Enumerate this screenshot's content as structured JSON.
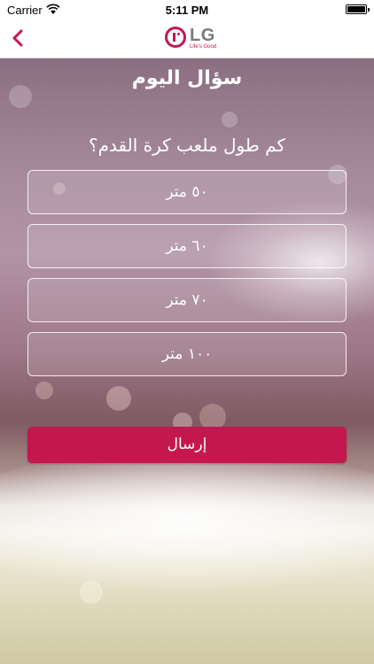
{
  "status_bar": {
    "carrier": "Carrier",
    "time": "5:11 PM",
    "wifi_icon": "wifi-icon",
    "battery_icon": "battery-icon"
  },
  "nav": {
    "back_icon": "chevron-left-icon",
    "logo_text": "LG",
    "logo_tagline": "Life's Good"
  },
  "quiz": {
    "title": "سؤال اليوم",
    "question": "كم طول ملعب كرة القدم؟",
    "options": [
      {
        "label": "٥٠ متر"
      },
      {
        "label": "٦٠ متر"
      },
      {
        "label": "٧٠ متر"
      },
      {
        "label": "١٠٠ متر"
      }
    ],
    "submit_label": "إرسال"
  },
  "colors": {
    "accent": "#c5174f",
    "option_border": "#ffffff",
    "text_on_background": "#ffffff"
  }
}
